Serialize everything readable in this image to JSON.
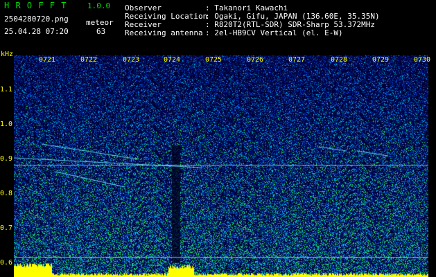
{
  "header": {
    "app_title": "H R O F F T",
    "version": "1.0.0",
    "filename": "2504280720.png",
    "datetime": "25.04.28 07:20",
    "meteor_label": "meteor",
    "meteor_count": "63",
    "info": [
      {
        "label": "Observer",
        "value": ": Takanori Kawachi"
      },
      {
        "label": "Receiving Location",
        "value": ": Ogaki, Gifu, JAPAN (136.60E, 35.35N)"
      },
      {
        "label": "Receiver",
        "value": ": R820T2(RTL-SDR) SDR-Sharp 53.372MHz"
      },
      {
        "label": "Receiving antenna",
        "value": ": 2el-HB9CV Vertical (el. E-W)"
      }
    ]
  },
  "axis": {
    "unit": "kHz",
    "freq_ticks": [
      "1.1",
      "1.0",
      "0.9",
      "0.8",
      "0.7",
      "0.6"
    ],
    "time_ticks": [
      "0721",
      "0722",
      "0723",
      "0724",
      "0725",
      "0726",
      "0727",
      "0728",
      "0729",
      "0730"
    ]
  }
}
